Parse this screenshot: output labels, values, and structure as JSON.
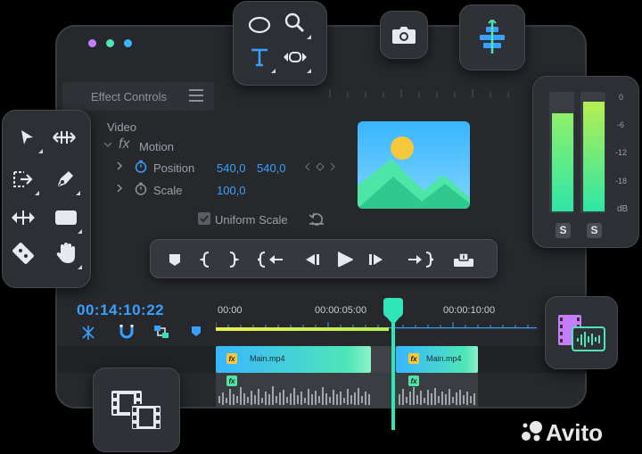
{
  "colors": {
    "accent": "#3aa0ff",
    "teal": "#2ee6b8",
    "window": "#26282c",
    "dot1": "#c77dff",
    "dot2": "#4ee6b8",
    "dot3": "#38b6ff"
  },
  "effect_controls": {
    "title": "Effect Controls",
    "section": "Video",
    "motion_label": "Motion",
    "position_label": "Position",
    "position_x": "540,0",
    "position_y": "540,0",
    "scale_label": "Scale",
    "scale_value": "100,0",
    "uniform_scale": "Uniform Scale"
  },
  "timeline": {
    "timecode": "00:14:10:22",
    "ruler": [
      "00:00",
      "00:00:05:00",
      "00:00:10:00"
    ],
    "clip1": "Main.mp4",
    "clip2": "Main.mp4",
    "fx": "fx"
  },
  "audio_meter": {
    "scale": [
      "0",
      "-6",
      "-12",
      "-18",
      "dB"
    ],
    "solo": [
      "S",
      "S"
    ],
    "levels": [
      0.82,
      0.92
    ]
  },
  "tools_left": [
    "selection-tool",
    "ripple-edit-tool",
    "track-select-tool",
    "pen-tool",
    "move-tool",
    "rectangle-tool",
    "slip-tool",
    "hand-tool"
  ],
  "tools_top": [
    "ellipse-tool",
    "zoom-tool",
    "type-tool",
    "rate-stretch-tool"
  ],
  "watermark": "Avito"
}
